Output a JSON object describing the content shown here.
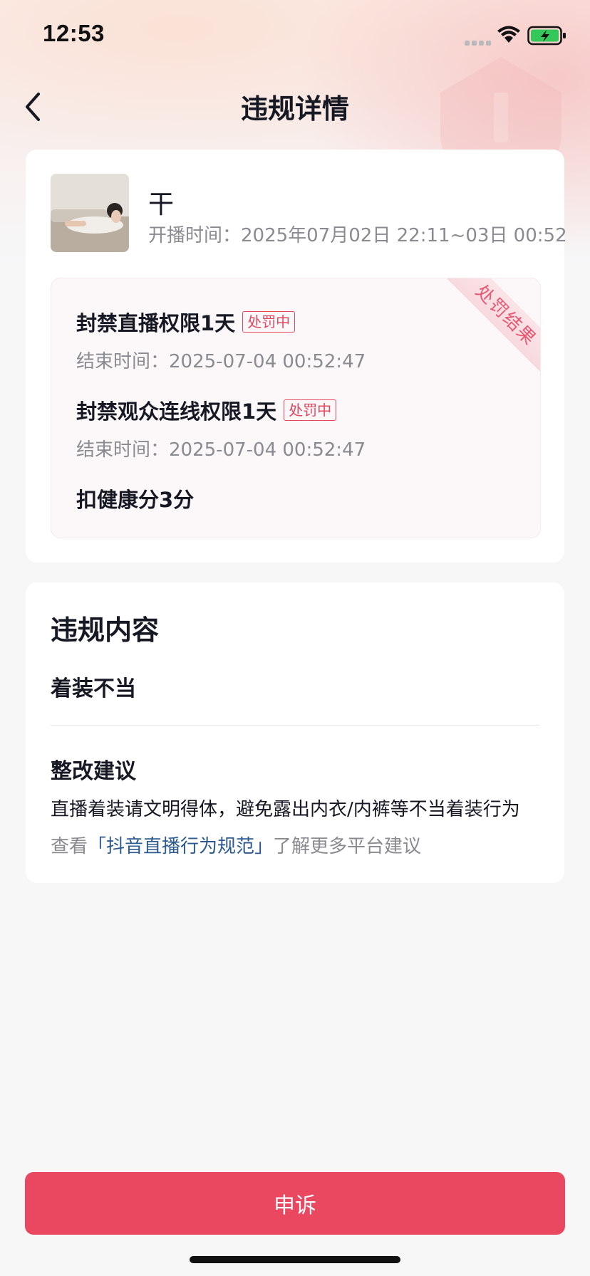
{
  "status_bar": {
    "time": "12:53",
    "icons": [
      "cellular-icon",
      "wifi-icon",
      "battery-charging-icon"
    ]
  },
  "nav": {
    "title": "违规详情",
    "back_icon": "chevron-left-icon"
  },
  "summary": {
    "streamer_name": "干",
    "live_time_label": "开播时间：",
    "live_time_value": "2025年07月02日 22:11~03日 00:52",
    "ribbon_label": "处罚结果",
    "penalties": [
      {
        "title": "封禁直播权限1天",
        "status": "处罚中",
        "end_label": "结束时间：",
        "end_time": "2025-07-04 00:52:47"
      },
      {
        "title": "封禁观众连线权限1天",
        "status": "处罚中",
        "end_label": "结束时间：",
        "end_time": "2025-07-04 00:52:47"
      },
      {
        "title": "扣健康分3分"
      }
    ]
  },
  "violation": {
    "heading": "违规内容",
    "content": "着装不当",
    "advice_heading": "整改建议",
    "advice_text": "直播着装请文明得体，避免露出内衣/内裤等不当着装行为",
    "more_prefix": "查看",
    "more_link": "「抖音直播行为规范」",
    "more_suffix": "了解更多平台建议"
  },
  "footer": {
    "appeal_label": "申诉"
  },
  "colors": {
    "accent": "#ea4761",
    "tag": "#e3465f",
    "link": "#2c5a8f",
    "ribbon_text": "#e85772"
  }
}
